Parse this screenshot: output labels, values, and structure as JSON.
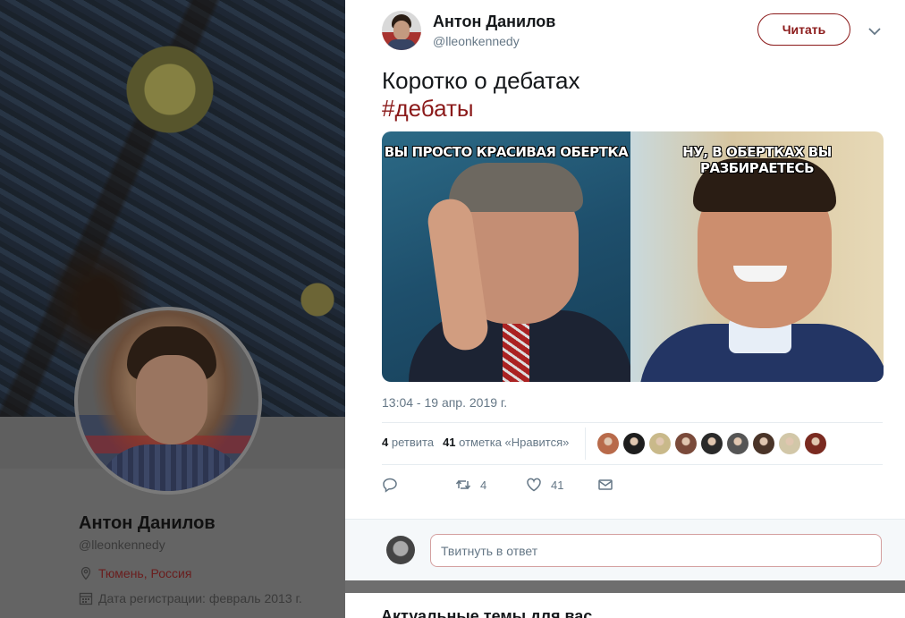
{
  "profile": {
    "name": "Антон Данилов",
    "handle": "@lleonkennedy",
    "location": "Тюмень, Россия",
    "joined": "Дата регистрации: февраль 2013 г."
  },
  "tweet": {
    "author_name": "Антон Данилов",
    "author_handle": "@lleonkennedy",
    "follow_label": "Читать",
    "text": "Коротко о дебатах",
    "hashtag": "#дебаты",
    "image_caption_left": "ВЫ ПРОСТО КРАСИВАЯ ОБЕРТКА",
    "image_caption_right": "НУ, В ОБЕРТКАХ ВЫ РАЗБИРАЕТЕСЬ",
    "timestamp": "13:04 - 19 апр. 2019 г.",
    "retweets_count": "4",
    "retweets_label": "ретвита",
    "likes_count": "41",
    "likes_label": "отметка «Нравится»",
    "action_retweet_count": "4",
    "action_like_count": "41",
    "reply_placeholder": "Твитнуть в ответ"
  },
  "sidebar_section_title": "Актуальные темы для вас",
  "colors": {
    "accent": "#8b1a1a",
    "muted": "#657786"
  },
  "likers": [
    "#b86a4a",
    "#1d1d1d",
    "#c9b98a",
    "#7a4a3a",
    "#2a2a2a",
    "#555555",
    "#4a3428",
    "#d2c7a8",
    "#7a2a20"
  ]
}
